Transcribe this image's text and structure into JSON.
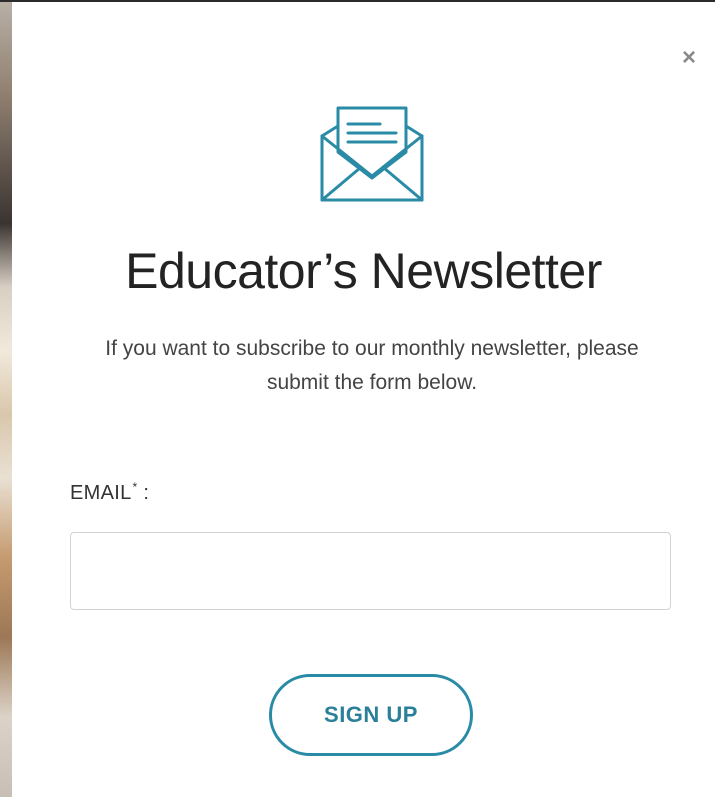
{
  "modal": {
    "close_icon": "close-icon",
    "close_glyph": "×",
    "icon": "envelope-letter-icon",
    "title": "Educator’s Newsletter",
    "description": "If you want to subscribe to our monthly newsletter, please submit the form below."
  },
  "form": {
    "email_label": "EMAIL",
    "required_mark": "*",
    "label_suffix": " :",
    "email_value": "",
    "email_placeholder": "",
    "submit_label": "SIGN UP"
  },
  "colors": {
    "accent": "#2a8ba6",
    "title_text": "#232323",
    "body_text": "#444444",
    "input_border": "#d3d3d3"
  }
}
